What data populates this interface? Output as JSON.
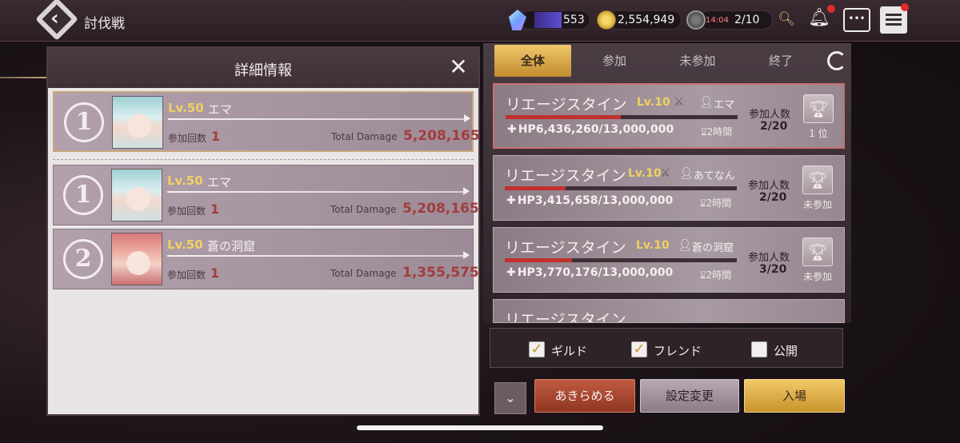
{
  "header": {
    "title": "討伐戦",
    "crystal": "553",
    "coins": "2,554,949",
    "stamina_timer": "14:04",
    "stamina": "2/10"
  },
  "detail": {
    "title": "詳細情報",
    "close": "✕",
    "count_label": "参加回数",
    "damage_label": "Total Damage",
    "rows": [
      {
        "rank": "1",
        "lv": "Lv.50",
        "name": "エマ",
        "count": "1",
        "damage": "5,208,165"
      },
      {
        "rank": "1",
        "lv": "Lv.50",
        "name": "エマ",
        "count": "1",
        "damage": "5,208,165"
      },
      {
        "rank": "2",
        "lv": "Lv.50",
        "name": "蒼の洞窟",
        "count": "1",
        "damage": "1,355,575"
      }
    ]
  },
  "tabs": [
    "全体",
    "参加",
    "未参加",
    "終了"
  ],
  "events": [
    {
      "title": "リエージスタイン",
      "lv": "Lv.10",
      "owner": "エマ",
      "hp": "HP6,436,260/13,000,000",
      "hp_fraction": 0.495,
      "time": "2時間",
      "participants_label": "参加人数",
      "participants": "2/20",
      "status": "1 位"
    },
    {
      "title": "リエージスタイン",
      "lv": "Lv.10",
      "owner": "あてなん",
      "hp": "HP3,415,658/13,000,000",
      "hp_fraction": 0.263,
      "time": "2時間",
      "participants_label": "参加人数",
      "participants": "2/20",
      "status": "未参加"
    },
    {
      "title": "リエージスタイン",
      "lv": "Lv.10",
      "owner": "蒼の洞窟",
      "hp": "HP3,770,176/13,000,000",
      "hp_fraction": 0.29,
      "time": "2時間",
      "participants_label": "参加人数",
      "participants": "3/20",
      "status": "未参加"
    }
  ],
  "filters": {
    "guild": "ギルド",
    "friend": "フレンド",
    "public": "公開"
  },
  "buttons": {
    "give_up": "あきらめる",
    "change_settings": "設定変更",
    "enter": "入場"
  },
  "colors": {
    "accent_gold": "#f0c76a",
    "damage_red": "#a23d3d",
    "hp_red": "#c0302e"
  }
}
